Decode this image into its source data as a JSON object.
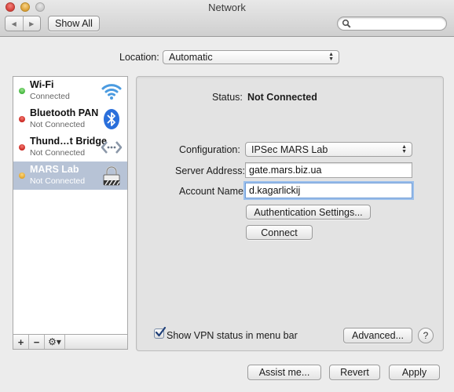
{
  "window": {
    "title": "Network",
    "back_glyph": "◀",
    "forward_glyph": "▶",
    "show_all_label": "Show All",
    "search_placeholder": ""
  },
  "location": {
    "label": "Location:",
    "value": "Automatic"
  },
  "services": [
    {
      "name": "Wi-Fi",
      "status": "Connected",
      "dot_color": "#3fb43a",
      "icon": "wifi-icon",
      "selected": false
    },
    {
      "name": "Bluetooth PAN",
      "status": "Not Connected",
      "dot_color": "#d3302a",
      "icon": "bluetooth-icon",
      "selected": false
    },
    {
      "name": "Thund…t Bridge",
      "status": "Not Connected",
      "dot_color": "#d3302a",
      "icon": "thunderbolt-bridge-icon",
      "selected": false
    },
    {
      "name": "MARS Lab",
      "status": "Not Connected",
      "dot_color": "#e2a42a",
      "icon": "vpn-lock-icon",
      "selected": true
    }
  ],
  "sidebar_toolbar": {
    "add": "+",
    "remove": "−",
    "gear": "⚙▾"
  },
  "detail": {
    "status_label": "Status:",
    "status_value": "Not Connected",
    "configuration_label": "Configuration:",
    "configuration_value": "IPSec MARS Lab",
    "server_label": "Server Address:",
    "server_value": "gate.mars.biz.ua",
    "account_label": "Account Name:",
    "account_value": "d.kagarlickij",
    "auth_button": "Authentication Settings...",
    "connect_button": "Connect",
    "show_vpn_label": "Show VPN status in menu bar",
    "show_vpn_checked": true,
    "advanced_button": "Advanced...",
    "help_glyph": "?"
  },
  "footer": {
    "assist_button": "Assist me...",
    "revert_button": "Revert",
    "apply_button": "Apply"
  }
}
